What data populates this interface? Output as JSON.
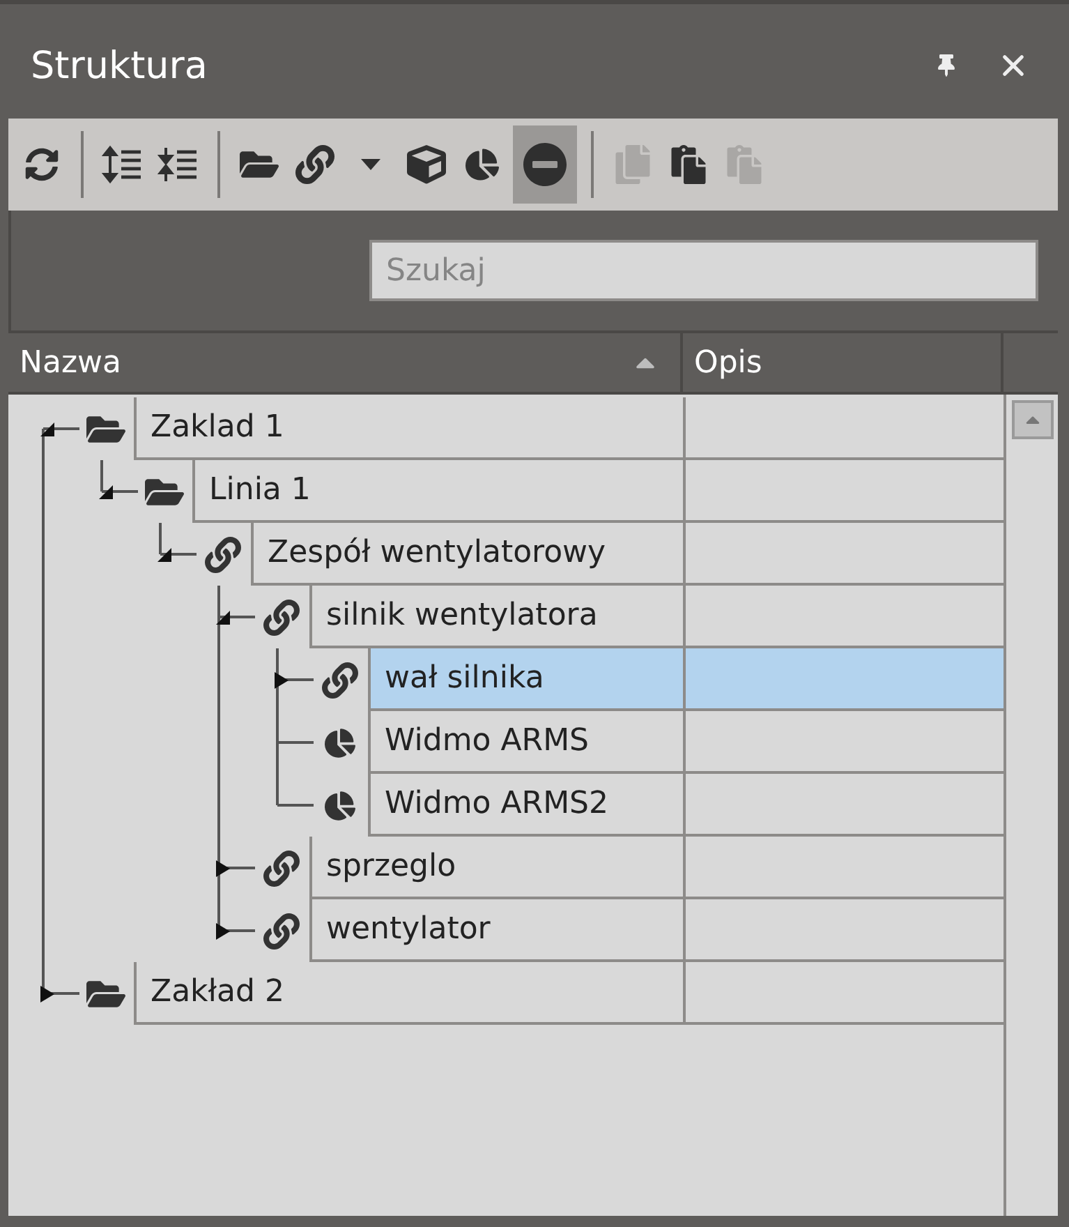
{
  "panel": {
    "title": "Struktura"
  },
  "toolbar": [
    {
      "kind": "refresh",
      "disabled": false,
      "pressed": false
    },
    {
      "kind": "separator"
    },
    {
      "kind": "expand-all",
      "disabled": false,
      "pressed": false
    },
    {
      "kind": "collapse-all",
      "disabled": false,
      "pressed": false
    },
    {
      "kind": "separator"
    },
    {
      "kind": "folder",
      "disabled": false,
      "pressed": false
    },
    {
      "kind": "link",
      "disabled": false,
      "pressed": false
    },
    {
      "kind": "dropdown",
      "disabled": false,
      "pressed": false
    },
    {
      "kind": "cube",
      "disabled": false,
      "pressed": false
    },
    {
      "kind": "pie",
      "disabled": false,
      "pressed": false
    },
    {
      "kind": "remove",
      "disabled": false,
      "pressed": true
    },
    {
      "kind": "separator"
    },
    {
      "kind": "copy",
      "disabled": true,
      "pressed": false
    },
    {
      "kind": "paste",
      "disabled": false,
      "pressed": false
    },
    {
      "kind": "paste",
      "disabled": true,
      "pressed": false
    }
  ],
  "search": {
    "placeholder": "Szukaj"
  },
  "table": {
    "columns": [
      {
        "label": "Nazwa",
        "sorted": true
      },
      {
        "label": "Opis",
        "sorted": false
      }
    ],
    "rows": [
      {
        "name": "Zaklad 1",
        "kind": "folder",
        "expanded": true,
        "selected": false,
        "children": [
          {
            "name": "Linia 1",
            "kind": "folder",
            "expanded": true,
            "selected": false,
            "children": [
              {
                "name": "Zespół wentylatorowy",
                "kind": "assembly",
                "expanded": true,
                "selected": false,
                "children": [
                  {
                    "name": "silnik wentylatora",
                    "kind": "assembly",
                    "expanded": true,
                    "selected": false,
                    "children": [
                      {
                        "name": "wał silnika",
                        "kind": "assembly",
                        "expanded": false,
                        "selected": true,
                        "has_children": true
                      },
                      {
                        "name": "Widmo ARMS",
                        "kind": "spectrum",
                        "selected": false
                      },
                      {
                        "name": "Widmo ARMS2",
                        "kind": "spectrum",
                        "selected": false
                      }
                    ]
                  },
                  {
                    "name": "sprzeglo",
                    "kind": "assembly",
                    "expanded": false,
                    "selected": false,
                    "has_children": true
                  },
                  {
                    "name": "wentylator",
                    "kind": "assembly",
                    "expanded": false,
                    "selected": false,
                    "has_children": true
                  }
                ]
              }
            ]
          }
        ]
      },
      {
        "name": "Zakład 2",
        "kind": "folder",
        "expanded": false,
        "selected": false,
        "has_children": true
      }
    ]
  }
}
